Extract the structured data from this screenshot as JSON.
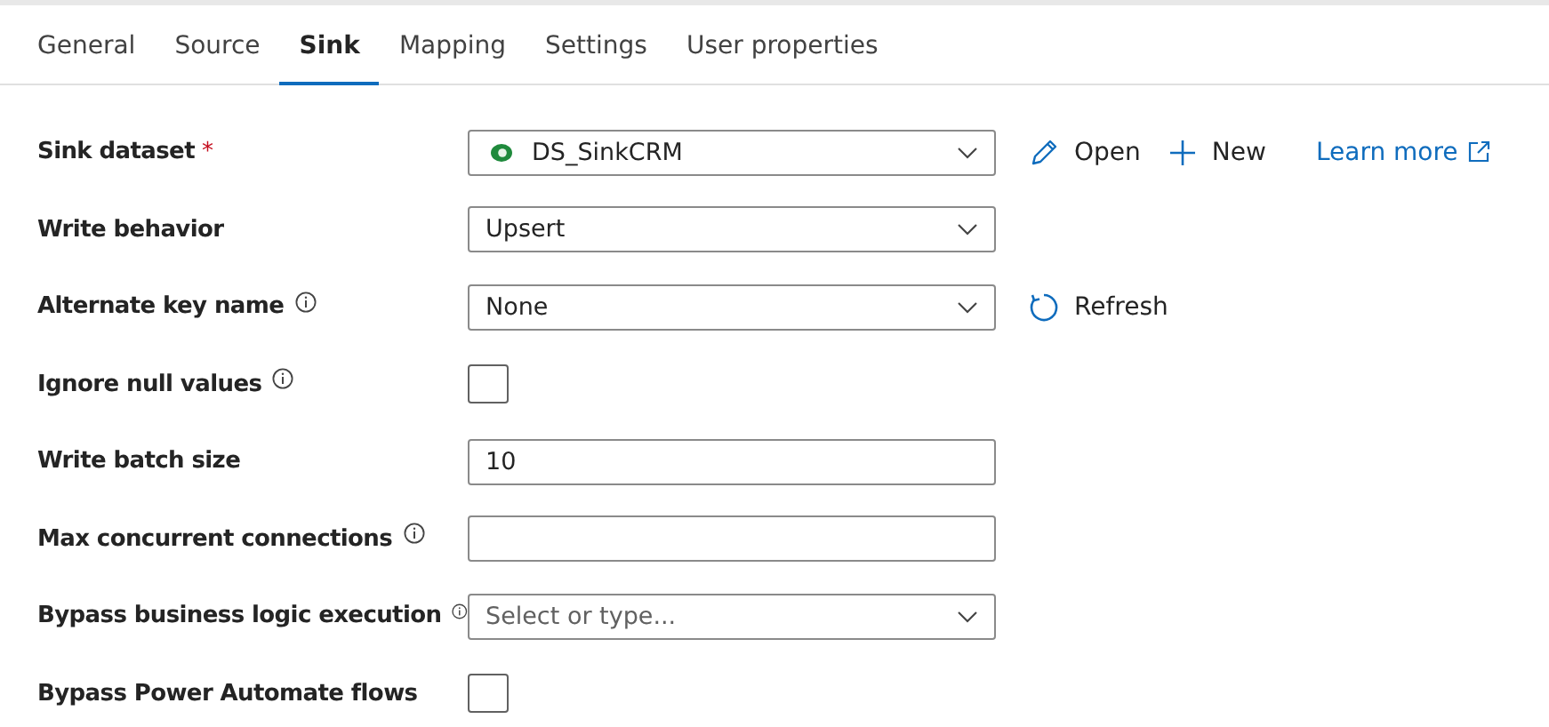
{
  "tabs": [
    {
      "label": "General",
      "selected": false
    },
    {
      "label": "Source",
      "selected": false
    },
    {
      "label": "Sink",
      "selected": true
    },
    {
      "label": "Mapping",
      "selected": false
    },
    {
      "label": "Settings",
      "selected": false
    },
    {
      "label": "User properties",
      "selected": false
    }
  ],
  "fields": [
    {
      "kind": "select",
      "label": "Sink dataset",
      "required_mark": "*",
      "info": false,
      "value": "DS_SinkCRM",
      "dataset_icon": true,
      "actions": [
        {
          "kind": "edit",
          "label": "Open"
        },
        {
          "kind": "new",
          "label": "New"
        },
        {
          "kind": "link",
          "label": "Learn more"
        }
      ]
    },
    {
      "kind": "select",
      "label": "Write behavior",
      "info": false,
      "value": "Upsert"
    },
    {
      "kind": "select",
      "label": "Alternate key name",
      "info": true,
      "value": "None",
      "actions": [
        {
          "kind": "refresh",
          "label": "Refresh"
        }
      ]
    },
    {
      "kind": "checkbox",
      "label": "Ignore null values",
      "info": true,
      "checked": false
    },
    {
      "kind": "text",
      "label": "Write batch size",
      "info": false,
      "value": "10"
    },
    {
      "kind": "text",
      "label": "Max concurrent connections",
      "info": true
    },
    {
      "kind": "select",
      "label": "Bypass business logic execution",
      "info": true,
      "placeholder": "Select or type..."
    },
    {
      "kind": "checkbox",
      "label": "Bypass Power Automate flows",
      "info": false,
      "checked": false
    }
  ]
}
